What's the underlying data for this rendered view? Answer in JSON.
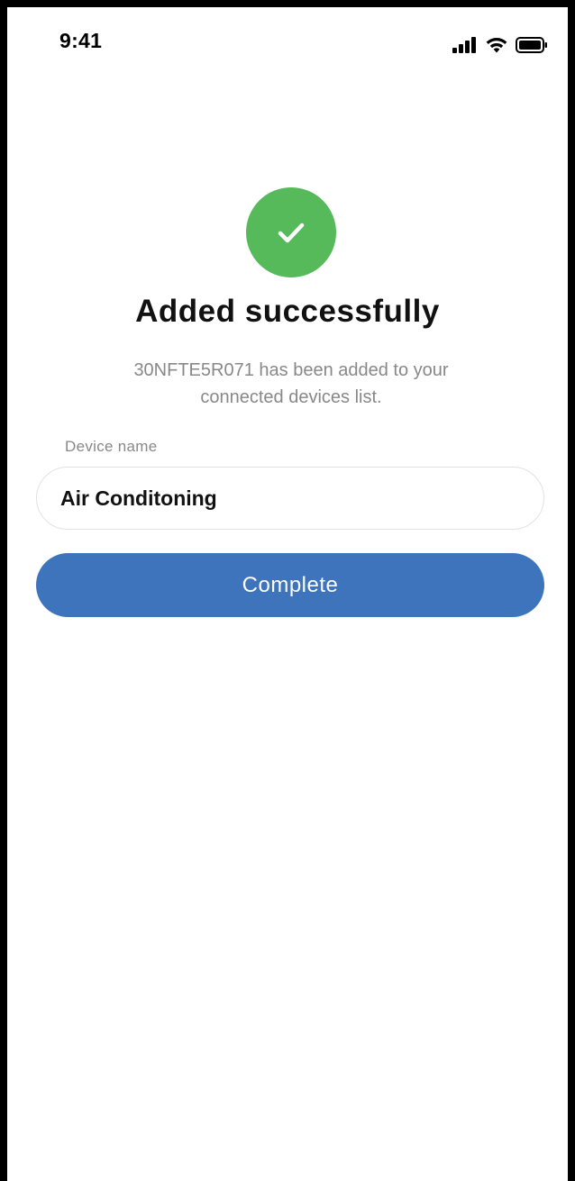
{
  "status_bar": {
    "time": "9:41",
    "icons": [
      "signal-icon",
      "wifi-icon",
      "battery-icon"
    ]
  },
  "success": {
    "icon": "check-icon",
    "icon_color": "#56ba5b",
    "title": "Added successfully",
    "description": "30NFTE5R071 has been added to your connected devices list."
  },
  "device_name": {
    "label": "Device name",
    "value": "Air Conditoning"
  },
  "complete_button": {
    "label": "Complete",
    "color": "#3d74bb"
  }
}
